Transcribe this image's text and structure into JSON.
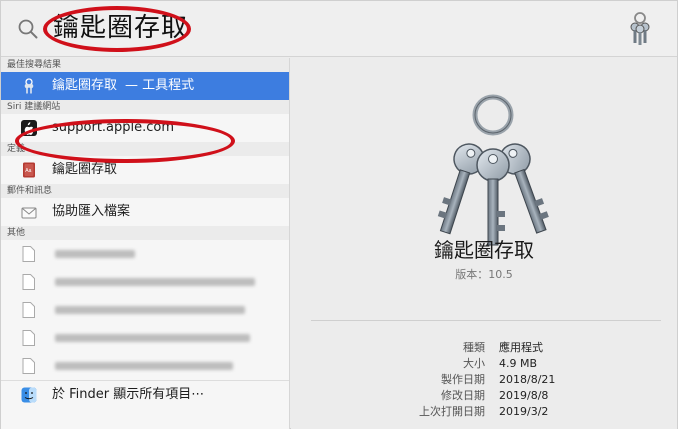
{
  "search": {
    "query": "鑰匙圈存取"
  },
  "results": {
    "sections": {
      "top_hit": "最佳搜尋結果",
      "siri": "Siri 建議網站",
      "definition": "定義",
      "mail": "郵件和訊息",
      "other": "其他"
    },
    "top_hit_item": {
      "label": "鑰匙圈存取",
      "sublabel": "— 工具程式"
    },
    "siri_item": {
      "label": "support.apple.com"
    },
    "definition_item": {
      "label": "鑰匙圈存取"
    },
    "mail_item": {
      "label": "協助匯入檔案"
    },
    "finder_item": {
      "label": "於 Finder 顯示所有項目⋯"
    }
  },
  "preview": {
    "title": "鑰匙圈存取",
    "version": "版本：10.5",
    "meta": [
      {
        "key": "種類",
        "value": "應用程式"
      },
      {
        "key": "大小",
        "value": "4.9 MB"
      },
      {
        "key": "製作日期",
        "value": "2018/8/21"
      },
      {
        "key": "修改日期",
        "value": "2019/8/8"
      },
      {
        "key": "上次打開日期",
        "value": "2019/3/2"
      }
    ]
  },
  "colors": {
    "selection": "#3d7de0",
    "annotation_ring": "#d0101a"
  },
  "icons": {
    "search": "search-icon",
    "app": "keychain-icon",
    "siri_site": "apple-icon",
    "dictionary": "dictionary-icon",
    "mail": "mail-icon",
    "document": "document-icon",
    "finder": "finder-icon"
  }
}
